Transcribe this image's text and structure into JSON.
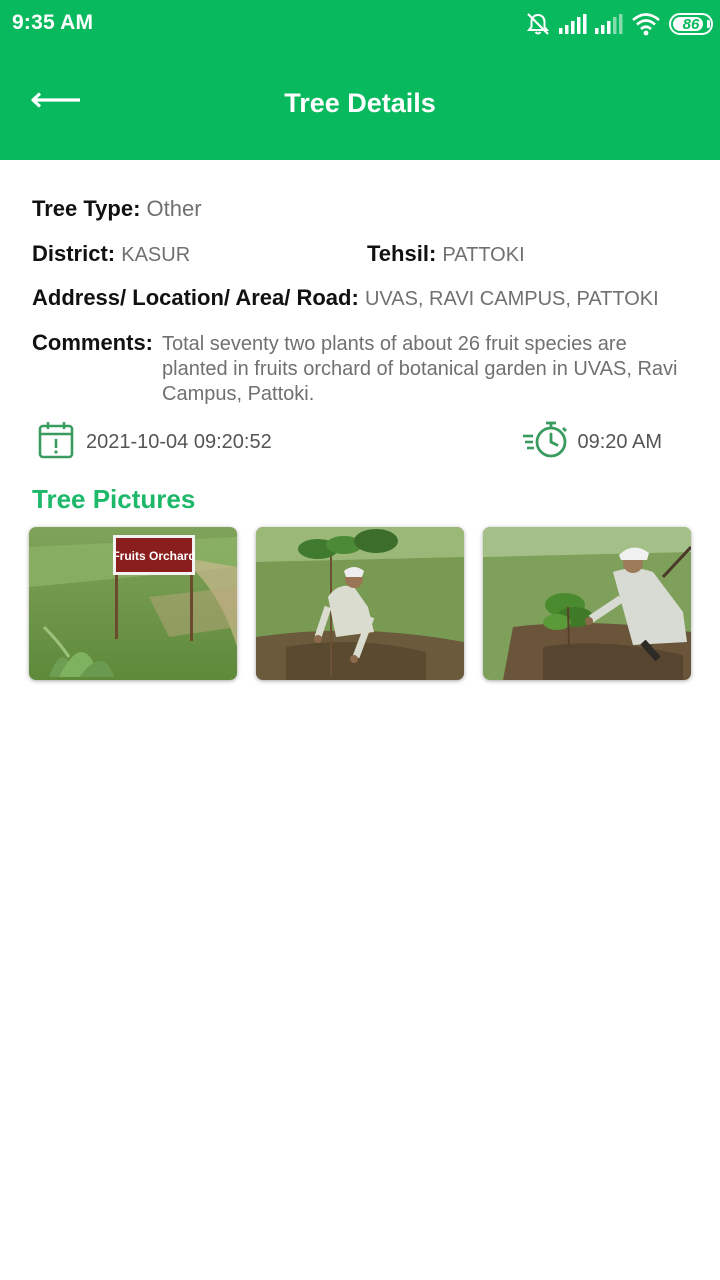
{
  "status_bar": {
    "time": "9:35 AM",
    "battery": "86",
    "battery_level_percent": 86,
    "icons": [
      "alarm-off-icon",
      "signal-icon",
      "signal-icon",
      "wifi-icon",
      "battery-icon"
    ]
  },
  "toolbar": {
    "title": "Tree Details",
    "back_icon": "arrow-left-icon"
  },
  "details": {
    "tree_type_label": "Tree Type:",
    "tree_type_value": "Other",
    "district_label": "District:",
    "district_value": "KASUR",
    "tehsil_label": "Tehsil:",
    "tehsil_value": "PATTOKI",
    "address_label": "Address/ Location/ Area/ Road:",
    "address_value": "UVAS, RAVI CAMPUS, PATTOKI",
    "comments_label": "Comments:",
    "comments_value": "Total seventy two plants of about 26 fruit species are planted in fruits orchard of botanical garden in UVAS, Ravi Campus, Pattoki."
  },
  "meta": {
    "date_icon": "calendar-alert-icon",
    "datetime": "2021-10-04 09:20:52",
    "time_icon": "timer-fast-icon",
    "time": "09:20 AM"
  },
  "pictures": {
    "title": "Tree Pictures",
    "items": [
      {
        "name": "tree-picture-1",
        "sign_text": "Fruits Orchard"
      },
      {
        "name": "tree-picture-2"
      },
      {
        "name": "tree-picture-3"
      }
    ]
  },
  "colors": {
    "primary": "#08b95e",
    "accent_text": "#1db86a",
    "icon_green": "#3a9b5f",
    "value_gray": "#707070"
  }
}
